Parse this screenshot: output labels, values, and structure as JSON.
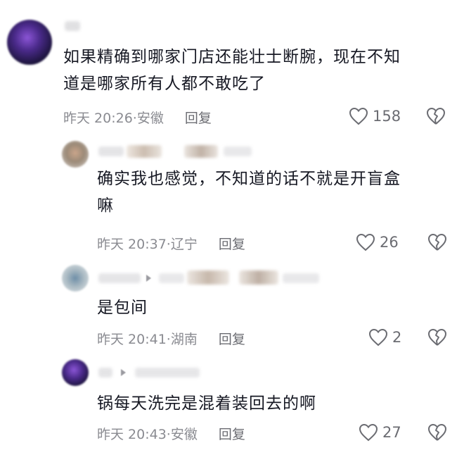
{
  "comments": [
    {
      "text": "如果精确到哪家门店还能壮士断腕，现在不知道是哪家所有人都不敢吃了",
      "line1": "如果精确到哪家门店还能壮士断腕，现在不知",
      "line2": "道是哪家所有人都不敢吃了",
      "time": "昨天 20:26",
      "location": "安徽",
      "reply_label": "回复",
      "likes": "158"
    },
    {
      "line1": "确实我也感觉，不知道的话不就是开盲盒",
      "line2": "嘛",
      "time": "昨天 20:37",
      "location": "辽宁",
      "reply_label": "回复",
      "likes": "26"
    },
    {
      "line1": "是包间",
      "time": "昨天 20:41",
      "location": "湖南",
      "reply_label": "回复",
      "likes": "2"
    },
    {
      "line1": "锅每天洗完是混着装回去的啊",
      "time": "昨天 20:43",
      "location": "安徽",
      "reply_label": "回复",
      "likes": "27"
    }
  ],
  "meta_separator": "·",
  "colors": {
    "text": "#161823",
    "meta": "#8a8b91",
    "icon": "#6b6c72"
  },
  "icons": {
    "like": "heart-icon",
    "dislike": "broken-heart-icon"
  }
}
